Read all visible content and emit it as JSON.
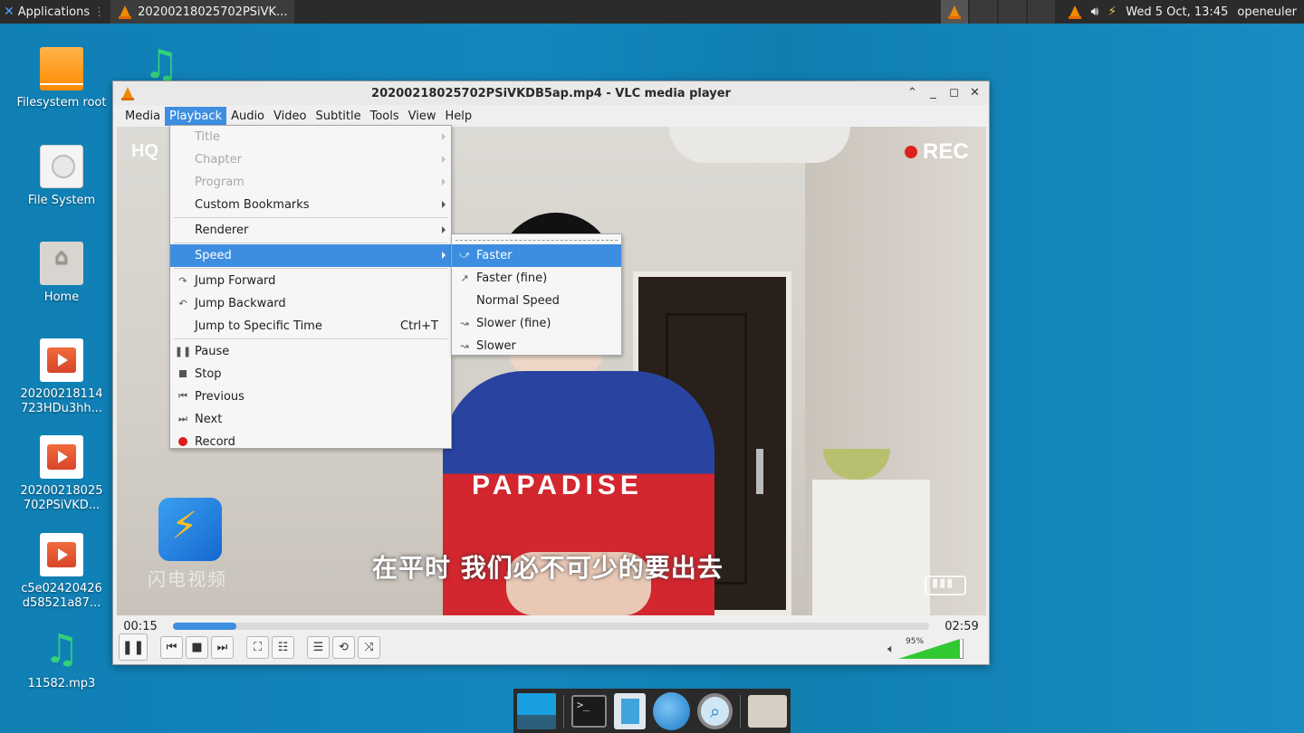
{
  "top_panel": {
    "applications_label": "Applications",
    "task_title": "20200218025702PSiVK...",
    "clock": "Wed  5 Oct, 13:45",
    "user": "openeuler"
  },
  "desktop_icons": [
    {
      "label": "Filesystem root"
    },
    {
      "label": "File System"
    },
    {
      "label": "Home"
    },
    {
      "label": "20200218114723HDu3hh..."
    },
    {
      "label": "20200218025702PSiVKD..."
    },
    {
      "label": "c5e02420426d58521a87..."
    },
    {
      "label": "11582.mp3"
    }
  ],
  "vlc": {
    "title": "20200218025702PSiVKDB5ap.mp4 - VLC media player",
    "menubar": [
      "Media",
      "Playback",
      "Audio",
      "Video",
      "Subtitle",
      "Tools",
      "View",
      "Help"
    ],
    "video": {
      "overlay_hq": "HQ",
      "overlay_rec": "REC",
      "shirt_text": "PAPADISE",
      "subtitle": "在平时 我们必不可少的要出去",
      "logo_text": "闪电视频"
    },
    "time_elapsed": "00:15",
    "time_total": "02:59",
    "progress_fraction": 0.084,
    "volume_label": "95%",
    "volume_fraction": 0.95
  },
  "playback_menu": {
    "title": "Title",
    "chapter": "Chapter",
    "program": "Program",
    "custom_bookmarks": "Custom Bookmarks",
    "renderer": "Renderer",
    "speed": "Speed",
    "jump_forward": "Jump Forward",
    "jump_backward": "Jump Backward",
    "jump_specific": "Jump to Specific Time",
    "jump_specific_shortcut": "Ctrl+T",
    "pause": "Pause",
    "stop": "Stop",
    "previous": "Previous",
    "next": "Next",
    "record": "Record"
  },
  "speed_menu": {
    "faster": "Faster",
    "faster_fine": "Faster (fine)",
    "normal": "Normal Speed",
    "slower_fine": "Slower (fine)",
    "slower": "Slower"
  },
  "colors": {
    "accent": "#3d8ee0",
    "desktop": "#1486bd",
    "panel": "#2b2b2b",
    "record_red": "#e01b1b",
    "volume_green": "#32c832"
  }
}
